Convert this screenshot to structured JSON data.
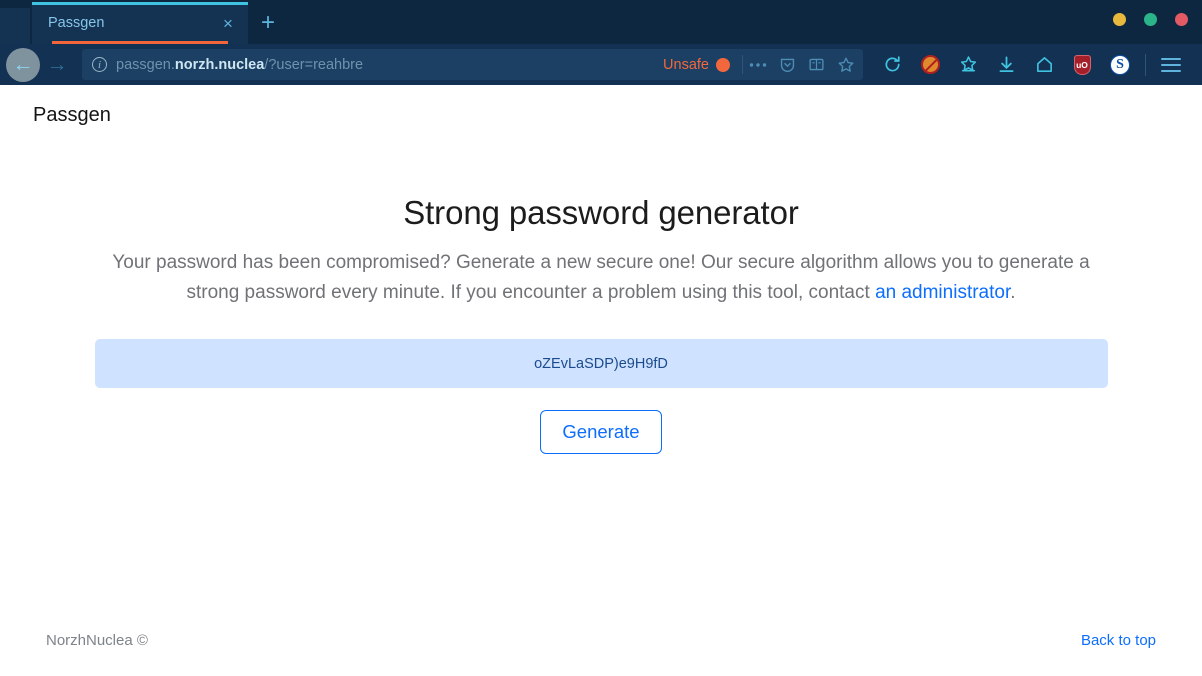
{
  "browser": {
    "tab": {
      "title": "Passgen",
      "close_label": "×"
    },
    "newtab_label": "+",
    "window_controls": [
      {
        "name": "minimize",
        "color": "#e8b93c"
      },
      {
        "name": "maximize",
        "color": "#2bb489"
      },
      {
        "name": "close",
        "color": "#e25a63"
      }
    ],
    "nav": {
      "back_label": "←",
      "forward_label": "→"
    },
    "url": {
      "prefix": "passgen.",
      "host": "norzh.nuclea",
      "path": "/?user=reahbre",
      "full": "passgen.norzh.nuclea/?user=reahbre",
      "security_label": "Unsafe",
      "security_color": "#f2673c"
    },
    "toolbar_icons": [
      "more-ellipsis-icon",
      "pocket-icon",
      "reader-view-icon",
      "bookmark-star-icon",
      "reload-icon",
      "adblock-icon",
      "save-to-pocket-icon",
      "downloads-icon",
      "home-icon",
      "ublock-origin-icon",
      "sync-s-icon",
      "menu-hamburger-icon"
    ],
    "ublock_label": "uO",
    "sync_label": "S"
  },
  "page": {
    "brand": "Passgen",
    "heading": "Strong password generator",
    "description_part1": "Your password has been compromised? Generate a new secure one! Our secure algorithm allows you to generate a strong password every minute. If you encounter a problem using this tool, contact ",
    "description_link": "an administrator",
    "description_part2": ".",
    "password_value": "oZEvLaSDP)e9H9fD",
    "generate_label": "Generate",
    "footer_left": "NorzhNuclea ©",
    "footer_right": "Back to top"
  },
  "colors": {
    "chrome_dark": "#0e2740",
    "chrome_nav": "#133152",
    "tab_active": "#143352",
    "tab_topline": "#3fc3e0",
    "tab_underline": "#f2663c",
    "accent_blue": "#0d6efd",
    "alert_bg": "#cfe2ff",
    "alert_text": "#1b4b8f"
  }
}
